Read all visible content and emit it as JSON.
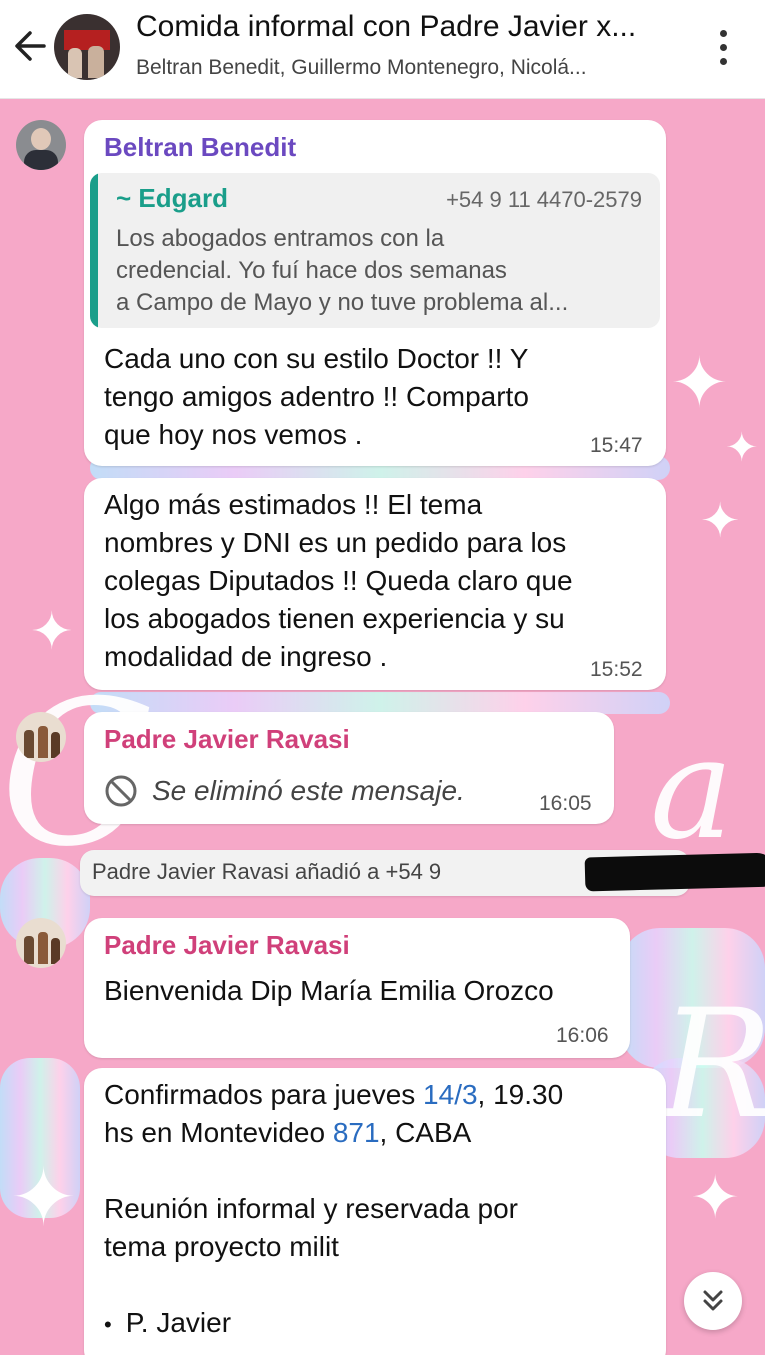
{
  "header": {
    "title": "Comida informal con Padre Javier x...",
    "subtitle": "Beltran Benedit, Guillermo Montenegro, Nicolá..."
  },
  "messages": [
    {
      "sender": "Beltran Benedit",
      "quote": {
        "name": "~ Edgard",
        "phone": "+54 9 11 4470-2579",
        "lines": [
          "Los abogados entramos con la",
          "credencial. Yo fuí hace dos semanas",
          "a Campo de Mayo y no tuve problema al..."
        ]
      },
      "lines": [
        "Cada uno con su estilo Doctor !! Y",
        "tengo amigos adentro !! Comparto",
        "que hoy nos vemos ."
      ],
      "time": "15:47"
    },
    {
      "lines": [
        "Algo más estimados !! El tema",
        "nombres y DNI es un pedido para los",
        "colegas Diputados  !! Queda claro que",
        "los abogados tienen experiencia y su",
        "modalidad de ingreso ."
      ],
      "time": "15:52"
    },
    {
      "sender": "Padre Javier Ravasi",
      "deleted": "Se eliminó este mensaje.",
      "time": "16:05"
    },
    {
      "system": "Padre Javier Ravasi añadió a +54 9"
    },
    {
      "sender": "Padre Javier Ravasi",
      "lines": [
        "Bienvenida Dip María Emilia Orozco"
      ],
      "time": "16:06"
    },
    {
      "line1": {
        "a": "Confirmados para jueves ",
        "link1": "14/3",
        "b": ", 19.30"
      },
      "line2": {
        "a": "hs en Montevideo ",
        "link2": "871",
        "b": ", CABA"
      },
      "lines": [
        "Reunión informal y reservada por",
        "tema proyecto milit"
      ],
      "bullet": "P. Javier"
    }
  ],
  "icons": {
    "back": "arrow-left-icon",
    "menu": "more-vertical-icon",
    "deleted": "block-icon",
    "scroll": "double-chevron-down-icon"
  },
  "colors": {
    "wallpaper": "#f6a8c8",
    "sender_purple": "#6b49c0",
    "sender_pink": "#d0407a",
    "quote_accent": "#1a9e8a",
    "link": "#2a6cc0"
  }
}
